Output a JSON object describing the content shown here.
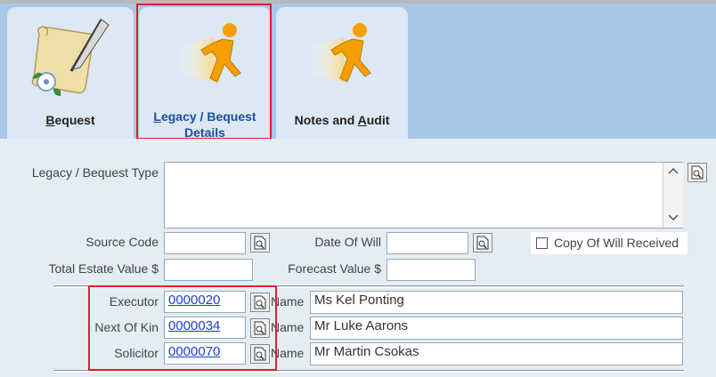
{
  "tabs": [
    {
      "label": "Bequest",
      "access_key": "B",
      "icon": "scroll-quill-icon",
      "active": false
    },
    {
      "label_line1": "Legacy / Bequest",
      "label_line2": "Details",
      "access_key": "L",
      "icon": "running-man-icon",
      "active": true
    },
    {
      "label": "Notes and Audit",
      "access_key": "A",
      "icon": "running-man-icon",
      "active": false
    }
  ],
  "form": {
    "legacy_type_label": "Legacy / Bequest Type",
    "legacy_type_value": "",
    "source_code_label": "Source Code",
    "source_code_value": "",
    "date_of_will_label": "Date Of Will",
    "date_of_will_value": "",
    "copy_of_will_label": "Copy Of Will Received",
    "copy_of_will_checked": false,
    "total_estate_label": "Total Estate Value $",
    "total_estate_value": "",
    "forecast_label": "Forecast Value $",
    "forecast_value": ""
  },
  "contacts": [
    {
      "role": "Executor",
      "id": "0000020",
      "name_label": "Name",
      "name": "Ms Kel Ponting"
    },
    {
      "role": "Next Of Kin",
      "id": "0000034",
      "name_label": "Name",
      "name": "Mr Luke Aarons"
    },
    {
      "role": "Solicitor",
      "id": "0000070",
      "name_label": "Name",
      "name": "Mr Martin Csokas"
    }
  ],
  "colors": {
    "accent_red": "#e0202a",
    "link_blue": "#1a3fcc",
    "tab_bg": "#dce8f4"
  }
}
